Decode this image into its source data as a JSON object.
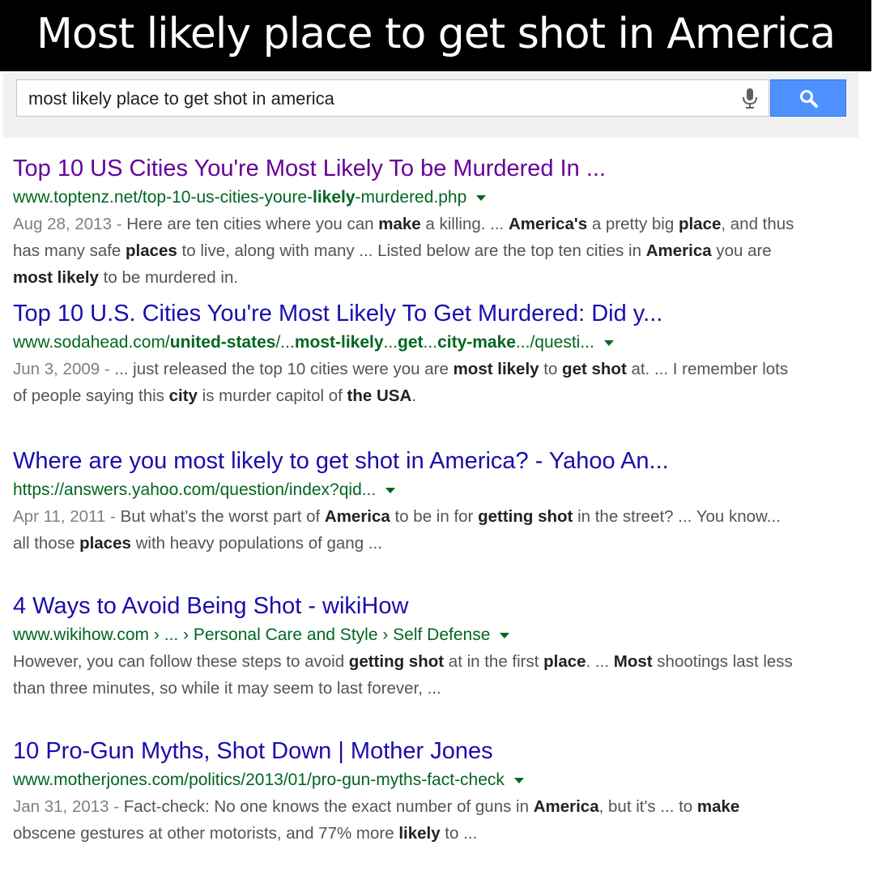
{
  "banner": {
    "title": "Most likely place to get shot in America"
  },
  "search": {
    "query": "most likely place to get shot in america",
    "mic_icon": "microphone-icon",
    "button_icon": "search-icon",
    "button_color": "#4d90fe"
  },
  "colors": {
    "link": "#1a0dab",
    "visited_link": "#660099",
    "url": "#006621",
    "snippet": "#545454"
  },
  "results": [
    {
      "title": "Top 10 US Cities You're Most Likely To be Murdered In ...",
      "visited": true,
      "url": {
        "p1": "www.toptenz.net/top-10-us-cities-youre-",
        "b1": "likely",
        "p2": "-murdered.php"
      },
      "snippet": {
        "date": "Aug 28, 2013 - ",
        "t1": "Here are ten cities where you can ",
        "b1": "make",
        "t2": " a killing. ... ",
        "b2": "America's",
        "t3": " a pretty big ",
        "b3": "place",
        "t4": ", and thus has many safe ",
        "b4": "places",
        "t5": " to live, along with many ... Listed below are the top ten cities in ",
        "b5": "America",
        "t6": " you are ",
        "b6": "most likely",
        "t7": " to be murdered in."
      }
    },
    {
      "title": "Top 10 U.S. Cities You're Most Likely To Get Murdered: Did y...",
      "visited": false,
      "url": {
        "p1": "www.sodahead.com/",
        "b1": "united-states",
        "p2": "/...",
        "b2": "most-likely",
        "p3": "...",
        "b3": "get",
        "p4": "...",
        "b4": "city-make",
        "p5": ".../questi..."
      },
      "snippet": {
        "date": "Jun 3, 2009 - ",
        "t1": "... just released the top 10 cities were you are ",
        "b1": "most likely",
        "t2": " to ",
        "b2": "get shot",
        "t3": " at. ... I remember lots of people saying this ",
        "b3": "city",
        "t4": " is murder capitol of ",
        "b4": "the USA",
        "t5": "."
      }
    },
    {
      "title": "Where are you most likely to get shot in America? - Yahoo An...",
      "visited": false,
      "url": {
        "p1": "https://answers.yahoo.com/question/index?qid..."
      },
      "snippet": {
        "date": "Apr 11, 2011 - ",
        "t1": "But what's the worst part of ",
        "b1": "America",
        "t2": " to be in for ",
        "b2": "getting shot",
        "t3": " in the street? ... You know... all those ",
        "b3": "places",
        "t4": " with heavy populations of gang ..."
      }
    },
    {
      "title": "4 Ways to Avoid Being Shot - wikiHow",
      "visited": false,
      "url": {
        "p1": "www.wikihow.com › ... › Personal Care and Style › Self Defense"
      },
      "snippet": {
        "t1": "However, you can follow these steps to avoid ",
        "b1": "getting shot",
        "t2": " at in the first ",
        "b2": "place",
        "t3": ". ... ",
        "b3": "Most",
        "t4": " shootings last less than three minutes, so while it may seem to last forever, ..."
      }
    },
    {
      "title": "10 Pro-Gun Myths, Shot Down | Mother Jones",
      "visited": false,
      "url": {
        "p1": "www.motherjones.com/politics/2013/01/pro-gun-myths-fact-check"
      },
      "snippet": {
        "date": "Jan 31, 2013 - ",
        "t1": "Fact-check: No one knows the exact number of guns in ",
        "b1": "America",
        "t2": ", but it's ... to ",
        "b2": "make",
        "t3": " obscene gestures at other motorists, and 77% more ",
        "b3": "likely",
        "t4": " to ..."
      }
    }
  ]
}
